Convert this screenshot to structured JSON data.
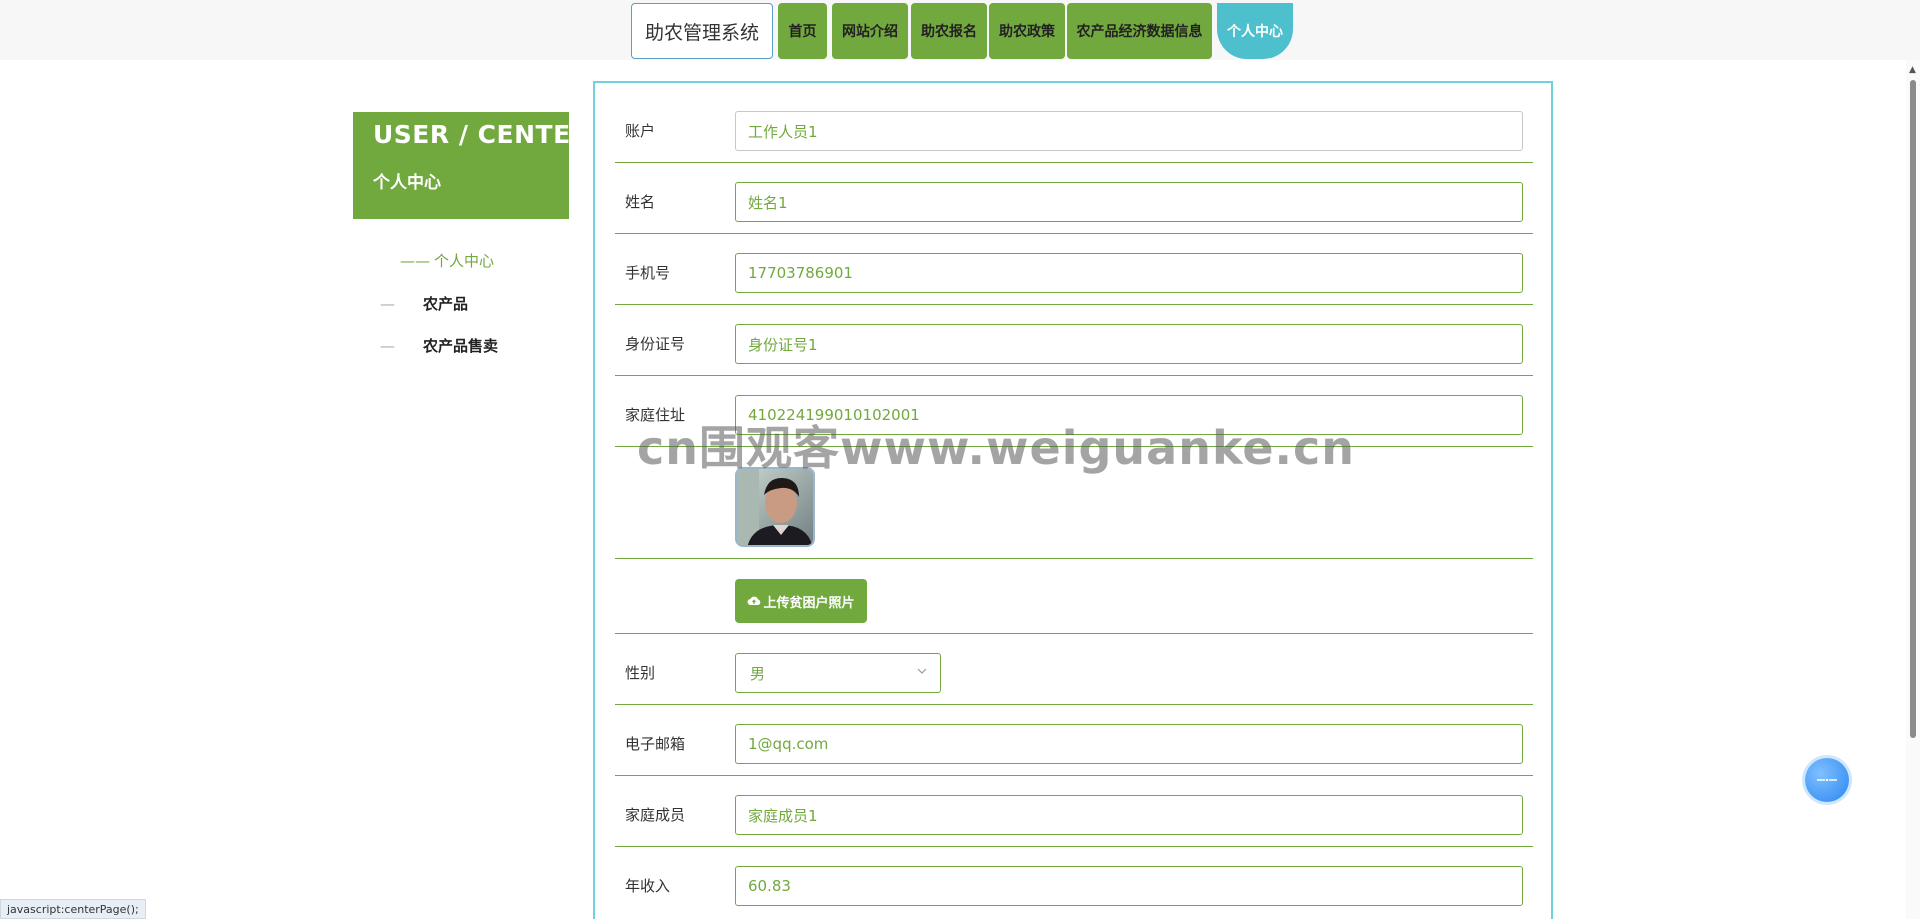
{
  "header": {
    "brand": "助农管理系统",
    "nav": [
      {
        "label": "首页"
      },
      {
        "label": "网站介绍"
      },
      {
        "label": "助农报名"
      },
      {
        "label": "助农政策"
      },
      {
        "label": "农产品经济数据信息"
      },
      {
        "label": "个人中心",
        "active": true
      }
    ]
  },
  "sidebar": {
    "title_en": "USER / CENTER",
    "title_cn": "个人中心",
    "items": [
      {
        "label": "个人中心",
        "active": true,
        "prefix": "——"
      },
      {
        "label": "农产品",
        "prefix": "—"
      },
      {
        "label": "农产品售卖",
        "prefix": "—"
      }
    ]
  },
  "form": {
    "account": {
      "label": "账户",
      "value": "工作人员1"
    },
    "name": {
      "label": "姓名",
      "value": "姓名1"
    },
    "phone": {
      "label": "手机号",
      "value": "17703786901"
    },
    "id_number": {
      "label": "身份证号",
      "value": "身份证号1"
    },
    "address": {
      "label": "家庭住址",
      "value": "410224199010102001"
    },
    "upload_button": "上传贫困户照片",
    "gender": {
      "label": "性别",
      "value": "男"
    },
    "email": {
      "label": "电子邮箱",
      "value": "1@qq.com"
    },
    "family": {
      "label": "家庭成员",
      "value": "家庭成员1"
    },
    "income": {
      "label": "年收入",
      "value": "60.83"
    }
  },
  "watermark": "cn围观客www.weiguanke.cn",
  "status_bar": "javascript:centerPage();",
  "icons": {
    "upload": "cloud-upload-icon",
    "chevron": "chevron-down-icon",
    "fab": "assistant-icon"
  },
  "colors": {
    "accent_green": "#72a93e",
    "active_cyan": "#4ec0cd",
    "card_border": "#6fd0de"
  }
}
